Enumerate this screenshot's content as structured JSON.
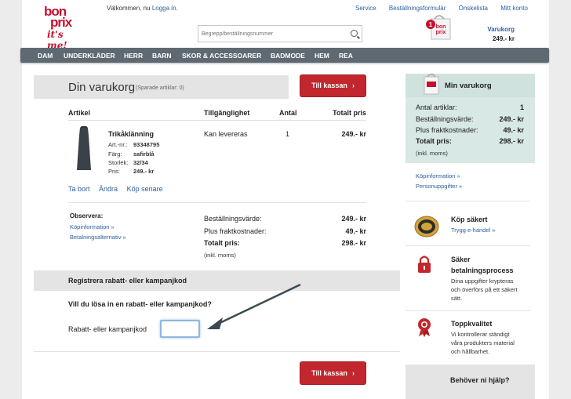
{
  "header": {
    "logo_line1": "bon",
    "logo_line2": "prix",
    "logo_tagline": "it's me!",
    "welcome_text": "Välkommen, nu",
    "login_link": "Logga in.",
    "top_links": [
      "Service",
      "Beställningsformulär",
      "Önskelista",
      "Mitt konto"
    ],
    "search_placeholder": "Begrepp/beställningsnummer",
    "cart_count": "1",
    "cart_label": "Varukorg",
    "cart_total": "249.- kr"
  },
  "nav": {
    "items": [
      "DAM",
      "UNDERKLÄDER",
      "HERR",
      "BARN",
      "SKOR & ACCESSOARER",
      "BADMODE",
      "HEM",
      "REA"
    ]
  },
  "cart": {
    "title": "Din varukorg",
    "saved": "(Sparade artiklar: 0)",
    "checkout_label": "Till kassan",
    "col_article": "Artikel",
    "col_availability": "Tillgänglighet",
    "col_qty": "Antal",
    "col_total": "Totalt pris",
    "item": {
      "name": "Trikåklänning",
      "art_label": "Art.-nr.:",
      "art_value": "93348795",
      "color_label": "Färg:",
      "color_value": "safirblå",
      "size_label": "Storlek:",
      "size_value": "32/34",
      "price_label": "Pris:",
      "price_value": "249.- kr",
      "availability": "Kan levereras",
      "qty": "1",
      "total": "249.- kr"
    },
    "actions": [
      "Ta bort",
      "Ändra",
      "Köp senare"
    ],
    "note_title": "Observera:",
    "note_links": [
      "Köpinformation »",
      "Betalningsalternativ »"
    ],
    "summary": {
      "order_value_label": "Beställningsvärde:",
      "order_value": "249.- kr",
      "shipping_label": "Plus fraktkostnader:",
      "shipping": "49.- kr",
      "total_label": "Totalt pris:",
      "total": "298.- kr",
      "vat_note": "(inkl. moms)"
    }
  },
  "promo": {
    "bar_title": "Registrera rabatt- eller kampanjkod",
    "question": "Vill du lösa in en rabatt- eller kampanjkod?",
    "field_label": "Rabatt- eller kampanjkod",
    "field_value": ""
  },
  "sidebar": {
    "mini_title": "Min varukorg",
    "rows": [
      {
        "label": "Antal artiklar:",
        "value": "1"
      },
      {
        "label": "Beställningsvärde:",
        "value": "249.- kr"
      },
      {
        "label": "Plus fraktkostnader:",
        "value": "49.- kr"
      },
      {
        "label": "Totalt pris:",
        "value": "298.- kr"
      }
    ],
    "vat_note": "(inkl. moms)",
    "links": [
      "Köpinformation »",
      "Personuppgifter »"
    ],
    "secure_title": "Köp säkert",
    "secure_link": "Trygg e-handel »",
    "process_title_1": "Säker",
    "process_title_2": "betalningsprocess",
    "process_desc_1": "Dina uppgifter krypteras",
    "process_desc_2": "och överförs på ett säkert",
    "process_desc_3": "sätt.",
    "quality_title": "Toppkvalitet",
    "quality_desc_1": "Vi kontrollerar ständigt",
    "quality_desc_2": "våra produkters material",
    "quality_desc_3": "och hållbarhet.",
    "help_title": "Behöver ni hjälp?"
  },
  "colors": {
    "brand_red": "#c8102e",
    "button_red": "#c1272d",
    "nav_bg": "#5f6972",
    "link_blue": "#2b5f9e",
    "mini_cart_bg": "#d8e8e5"
  }
}
